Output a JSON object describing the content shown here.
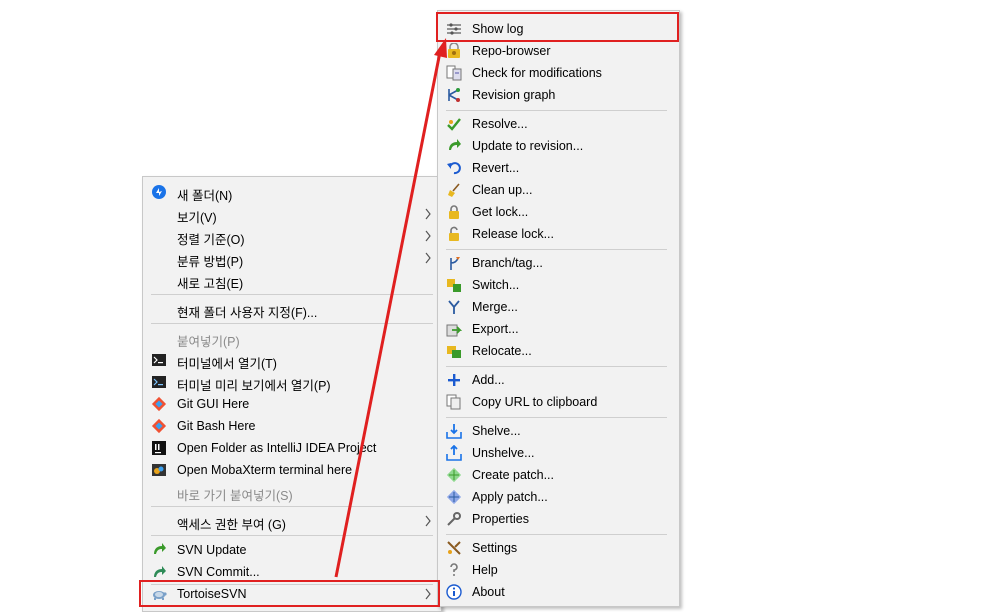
{
  "context_menu": {
    "items": [
      {
        "label": "새 폴더(N)",
        "icon": "new-folder-icon"
      },
      {
        "label": "보기(V)",
        "submenu": true
      },
      {
        "label": "정렬 기준(O)",
        "submenu": true
      },
      {
        "label": "분류 방법(P)",
        "submenu": true
      },
      {
        "label": "새로 고침(E)"
      },
      {
        "label": "현재 폴더 사용자 지정(F)..."
      },
      {
        "label": "붙여넣기(P)",
        "disabled": true
      },
      {
        "label": "터미널에서 열기(T)",
        "icon": "terminal-icon"
      },
      {
        "label": "터미널 미리 보기에서 열기(P)",
        "icon": "terminal-preview-icon"
      },
      {
        "label": "Git GUI Here",
        "icon": "git-gui-icon"
      },
      {
        "label": "Git Bash Here",
        "icon": "git-bash-icon"
      },
      {
        "label": "Open Folder as IntelliJ IDEA Project",
        "icon": "intellij-icon"
      },
      {
        "label": "Open MobaXterm terminal here",
        "icon": "mobaxterm-icon"
      },
      {
        "label": "바로 가기 붙여넣기(S)",
        "disabled": true
      },
      {
        "label": "액세스 권한 부여 (G)",
        "submenu": true
      },
      {
        "label": "SVN Update",
        "icon": "svn-update-icon"
      },
      {
        "label": "SVN Commit...",
        "icon": "svn-commit-icon"
      },
      {
        "label": "TortoiseSVN",
        "icon": "tortoisesvn-icon",
        "submenu": true
      }
    ]
  },
  "svn_menu": {
    "items": [
      {
        "label": "Show log",
        "icon": "show-log-icon"
      },
      {
        "label": "Repo-browser",
        "icon": "repo-browser-icon"
      },
      {
        "label": "Check for modifications",
        "icon": "check-modifications-icon"
      },
      {
        "label": "Revision graph",
        "icon": "revision-graph-icon"
      },
      {
        "label": "Resolve...",
        "icon": "resolve-icon"
      },
      {
        "label": "Update to revision...",
        "icon": "update-revision-icon"
      },
      {
        "label": "Revert...",
        "icon": "revert-icon"
      },
      {
        "label": "Clean up...",
        "icon": "cleanup-icon"
      },
      {
        "label": "Get lock...",
        "icon": "get-lock-icon"
      },
      {
        "label": "Release lock...",
        "icon": "release-lock-icon"
      },
      {
        "label": "Branch/tag...",
        "icon": "branch-tag-icon"
      },
      {
        "label": "Switch...",
        "icon": "switch-icon"
      },
      {
        "label": "Merge...",
        "icon": "merge-icon"
      },
      {
        "label": "Export...",
        "icon": "export-icon"
      },
      {
        "label": "Relocate...",
        "icon": "relocate-icon"
      },
      {
        "label": "Add...",
        "icon": "add-icon"
      },
      {
        "label": "Copy URL to clipboard",
        "icon": "copy-url-icon"
      },
      {
        "label": "Shelve...",
        "icon": "shelve-icon"
      },
      {
        "label": "Unshelve...",
        "icon": "unshelve-icon"
      },
      {
        "label": "Create patch...",
        "icon": "create-patch-icon"
      },
      {
        "label": "Apply patch...",
        "icon": "apply-patch-icon"
      },
      {
        "label": "Properties",
        "icon": "properties-icon"
      },
      {
        "label": "Settings",
        "icon": "settings-icon"
      },
      {
        "label": "Help",
        "icon": "help-icon"
      },
      {
        "label": "About",
        "icon": "about-icon"
      }
    ]
  },
  "colors": {
    "highlight": "#e02020",
    "menu_bg": "#f2f2f2",
    "disabled_text": "#8a8a8a"
  }
}
